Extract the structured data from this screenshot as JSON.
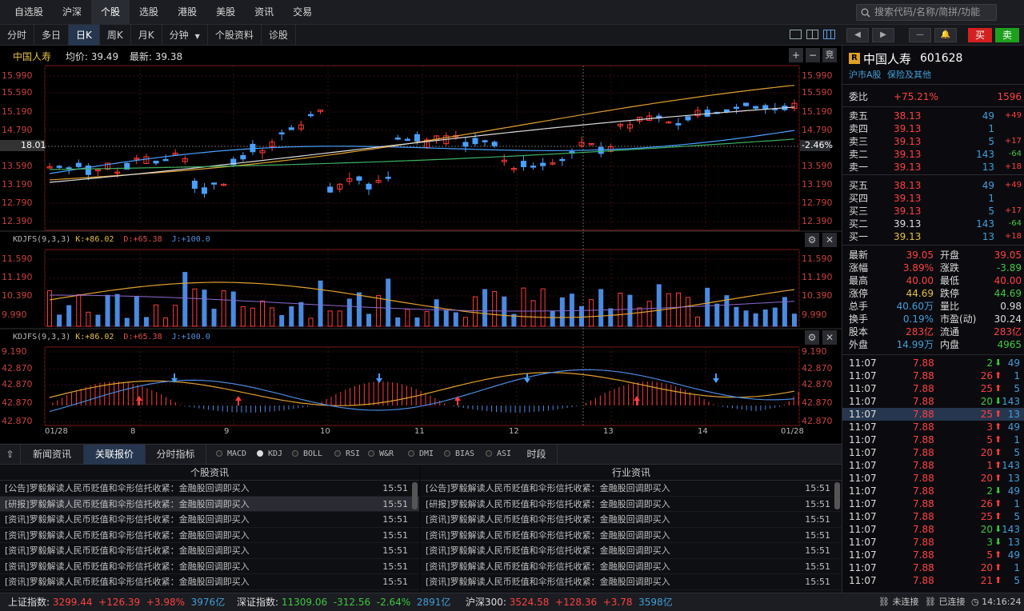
{
  "topnav": {
    "items": [
      "自选股",
      "沪深",
      "个股",
      "选股",
      "港股",
      "美股",
      "资讯",
      "交易"
    ],
    "active": 2,
    "search_placeholder": "搜索代码/名称/简拼/功能"
  },
  "period_tabs": {
    "items": [
      "分时",
      "多日",
      "日K",
      "周K",
      "月K",
      "分钟",
      "个股资料",
      "诊股"
    ],
    "active": 2,
    "dropdown_index": 5
  },
  "trade": {
    "sell_label": "买",
    "buy_label": "卖"
  },
  "chart": {
    "stock_name": "中国人寿",
    "avg_label": "均价:",
    "avg_value": "39.49",
    "last_label": "最新:",
    "last_value": "39.38",
    "crosshair_left": "18.01",
    "crosshair_right": "-2.46%"
  },
  "chart_data": [
    {
      "type": "candlestick",
      "left_ticks": [
        "15.990",
        "15.590",
        "15.190",
        "14.790",
        "13.590",
        "13.190",
        "12.790",
        "12.390"
      ],
      "right_ticks": [
        "15.990",
        "15.590",
        "15.190",
        "14.790",
        "13.590",
        "13.190",
        "12.790",
        "12.390"
      ]
    },
    {
      "type": "bar",
      "legend": {
        "name": "KDJFS(9,3,3)",
        "k": "K:+86.02",
        "d": "D:+65.38",
        "j": "J:+100.0"
      },
      "left_ticks": [
        "11.590",
        "11.190",
        "10.390",
        "9.990"
      ],
      "right_ticks": [
        "11.590",
        "11.190",
        "10.390",
        "9.990"
      ]
    },
    {
      "type": "bar",
      "legend": {
        "name": "KDJFS(9,3,3)",
        "k": "K:+86.02",
        "d": "D:+65.38",
        "j": "J:+100.0"
      },
      "left_ticks": [
        "9.190",
        "42.870",
        "42.870",
        "42.870",
        "42.870"
      ],
      "right_ticks": [
        "9.190",
        "42.870",
        "42.870",
        "42.870",
        "42.870"
      ],
      "x_labels": [
        "01/28",
        "8",
        "9",
        "10",
        "11",
        "12",
        "13",
        "14",
        "01/28"
      ]
    }
  ],
  "bottom_tabs": {
    "items": [
      "新闻资讯",
      "关联报价",
      "分时指标",
      "时段"
    ],
    "active": 1
  },
  "indicators": {
    "items": [
      "MACD",
      "KDJ",
      "BOLL",
      "RSI",
      "W&R",
      "DMI",
      "BIAS",
      "ASI"
    ],
    "active": 1
  },
  "news": {
    "left_header": "个股资讯",
    "right_header": "行业资讯",
    "left": [
      [
        "[公告]",
        "罗毅解读人民币贬值和伞形信托收紧：金融股回调即买入",
        "15:51"
      ],
      [
        "[研报]",
        "罗毅解读人民币贬值和伞形信托收紧：金融股回调即买入",
        "15:51"
      ],
      [
        "[资讯]",
        "罗毅解读人民币贬值和伞形信托收紧：金融股回调即买入",
        "15:51"
      ],
      [
        "[资讯]",
        "罗毅解读人民币贬值和伞形信托收紧：金融股回调即买入",
        "15:51"
      ],
      [
        "[资讯]",
        "罗毅解读人民币贬值和伞形信托收紧：金融股回调即买入",
        "15:51"
      ],
      [
        "[资讯]",
        "罗毅解读人民币贬值和伞形信托收紧：金融股回调即买入",
        "15:51"
      ],
      [
        "[资讯]",
        "罗毅解读人民币贬值和伞形信托收紧：金融股回调即买入",
        "15:51"
      ]
    ],
    "right": [
      [
        "[公告]",
        "罗毅解读人民币贬值和伞形信托收紧：金融股回调即买入",
        "15:51"
      ],
      [
        "[研报]",
        "罗毅解读人民币贬值和伞形信托收紧：金融股回调即买入",
        "15:51"
      ],
      [
        "[资讯]",
        "罗毅解读人民币贬值和伞形信托收紧：金融股回调即买入",
        "15:51"
      ],
      [
        "[资讯]",
        "罗毅解读人民币贬值和伞形信托收紧：金融股回调即买入",
        "15:51"
      ],
      [
        "[资讯]",
        "罗毅解读人民币贬值和伞形信托收紧：金融股回调即买入",
        "15:51"
      ],
      [
        "[资讯]",
        "罗毅解读人民币贬值和伞形信托收紧：金融股回调即买入",
        "15:51"
      ],
      [
        "[资讯]",
        "罗毅解读人民币贬值和伞形信托收紧：金融股回调即买入",
        "15:51"
      ]
    ],
    "selected_left": 1
  },
  "quote": {
    "badge": "R",
    "name": "中国人寿",
    "code": "601628",
    "market": "沪市A股",
    "sector": "保险及其他",
    "weibi_label": "委比",
    "weibi": "+75.21%",
    "weicha": "1596",
    "sells": [
      [
        "卖五",
        "38.13",
        "49",
        "+49"
      ],
      [
        "卖四",
        "39.13",
        "1",
        ""
      ],
      [
        "卖三",
        "39.13",
        "5",
        "+17"
      ],
      [
        "卖二",
        "39.13",
        "143",
        "-64"
      ],
      [
        "卖一",
        "39.13",
        "13",
        "+18"
      ]
    ],
    "buys": [
      [
        "买五",
        "38.13",
        "49",
        "+49"
      ],
      [
        "买四",
        "39.13",
        "1",
        ""
      ],
      [
        "买三",
        "39.13",
        "5",
        "+17"
      ],
      [
        "买二",
        "39.13",
        "143",
        "-64"
      ],
      [
        "买一",
        "39.13",
        "13",
        "+18"
      ]
    ],
    "stats": [
      [
        "最新",
        "39.05",
        "开盘",
        "39.05"
      ],
      [
        "涨幅",
        "3.89%",
        "涨跌",
        "-3.89"
      ],
      [
        "最高",
        "40.00",
        "最低",
        "40.00"
      ],
      [
        "涨停",
        "44.69",
        "跌停",
        "44.69"
      ],
      [
        "总手",
        "40.60万",
        "量比",
        "0.98"
      ],
      [
        "换手",
        "0.19%",
        "市盈(动)",
        "30.24"
      ],
      [
        "股本",
        "283亿",
        "流通",
        "283亿"
      ],
      [
        "外盘",
        "14.99万",
        "内盘",
        "4965"
      ]
    ],
    "ticks": [
      [
        "11:07",
        "7.88",
        "2",
        "down",
        "49"
      ],
      [
        "11:07",
        "7.88",
        "26",
        "up",
        "1"
      ],
      [
        "11:07",
        "7.88",
        "25",
        "up",
        "5"
      ],
      [
        "11:07",
        "7.88",
        "20",
        "down",
        "143"
      ],
      [
        "11:07",
        "7.88",
        "25",
        "up",
        "13"
      ],
      [
        "11:07",
        "7.88",
        "3",
        "up",
        "49"
      ],
      [
        "11:07",
        "7.88",
        "5",
        "up",
        "1"
      ],
      [
        "11:07",
        "7.88",
        "20",
        "up",
        "5"
      ],
      [
        "11:07",
        "7.88",
        "1",
        "up",
        "143"
      ],
      [
        "11:07",
        "7.88",
        "20",
        "up",
        "13"
      ],
      [
        "11:07",
        "7.88",
        "2",
        "down",
        "49"
      ],
      [
        "11:07",
        "7.88",
        "26",
        "up",
        "1"
      ],
      [
        "11:07",
        "7.88",
        "25",
        "up",
        "5"
      ],
      [
        "11:07",
        "7.88",
        "20",
        "down",
        "143"
      ],
      [
        "11:07",
        "7.88",
        "3",
        "down",
        "13"
      ],
      [
        "11:07",
        "7.88",
        "5",
        "up",
        "49"
      ],
      [
        "11:07",
        "7.88",
        "20",
        "up",
        "1"
      ],
      [
        "11:07",
        "7.88",
        "21",
        "up",
        "5"
      ]
    ],
    "selected_tick": 4
  },
  "status": {
    "sh": {
      "label": "上证指数:",
      "v": "3299.44",
      "c": "+126.39",
      "p": "+3.98%",
      "a": "3976亿"
    },
    "sz": {
      "label": "深证指数:",
      "v": "11309.06",
      "c": "-312.56",
      "p": "-2.64%",
      "a": "2891亿"
    },
    "hs": {
      "label": "沪深300:",
      "v": "3524.58",
      "c": "+128.36",
      "p": "+3.78",
      "a": "3598亿"
    },
    "conn1": "未连接",
    "conn2": "已连接",
    "time": "14:16:24"
  }
}
